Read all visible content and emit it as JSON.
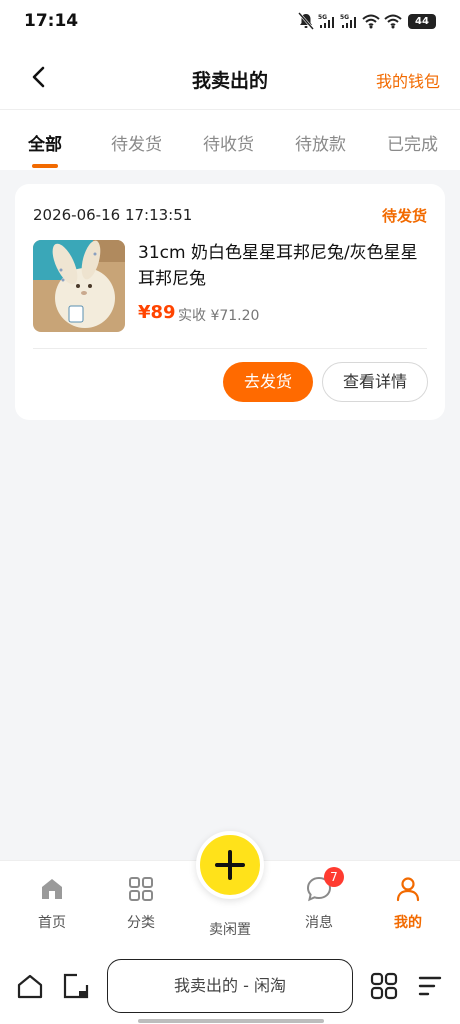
{
  "status_bar": {
    "time": "17:14",
    "battery": "44",
    "network_1": "5G",
    "network_2": "5G"
  },
  "header": {
    "title": "我卖出的",
    "wallet_link": "我的钱包"
  },
  "tabs": [
    {
      "label": "全部",
      "active": true
    },
    {
      "label": "待发货",
      "active": false
    },
    {
      "label": "待收货",
      "active": false
    },
    {
      "label": "待放款",
      "active": false
    },
    {
      "label": "已完成",
      "active": false
    }
  ],
  "order": {
    "time": "2026-06-16 17:13:51",
    "status": "待发货",
    "title": "31cm 奶白色星星耳邦尼兔/灰色星星耳邦尼兔",
    "price": "¥89",
    "received": "实收 ¥71.20",
    "ship_button": "去发货",
    "detail_button": "查看详情"
  },
  "bottom_nav": {
    "items": [
      {
        "label": "首页",
        "icon": "home-icon"
      },
      {
        "label": "分类",
        "icon": "grid-icon"
      },
      {
        "label": "卖闲置",
        "icon": "plus-icon"
      },
      {
        "label": "消息",
        "icon": "chat-icon",
        "badge": "7"
      },
      {
        "label": "我的",
        "icon": "person-icon",
        "active": true
      }
    ]
  },
  "system_bar": {
    "search_text": "我卖出的 - 闲淘"
  },
  "colors": {
    "accent": "#f26a00",
    "price": "#ff4400",
    "fab": "#ffe21a",
    "badge": "#ff3b30"
  }
}
